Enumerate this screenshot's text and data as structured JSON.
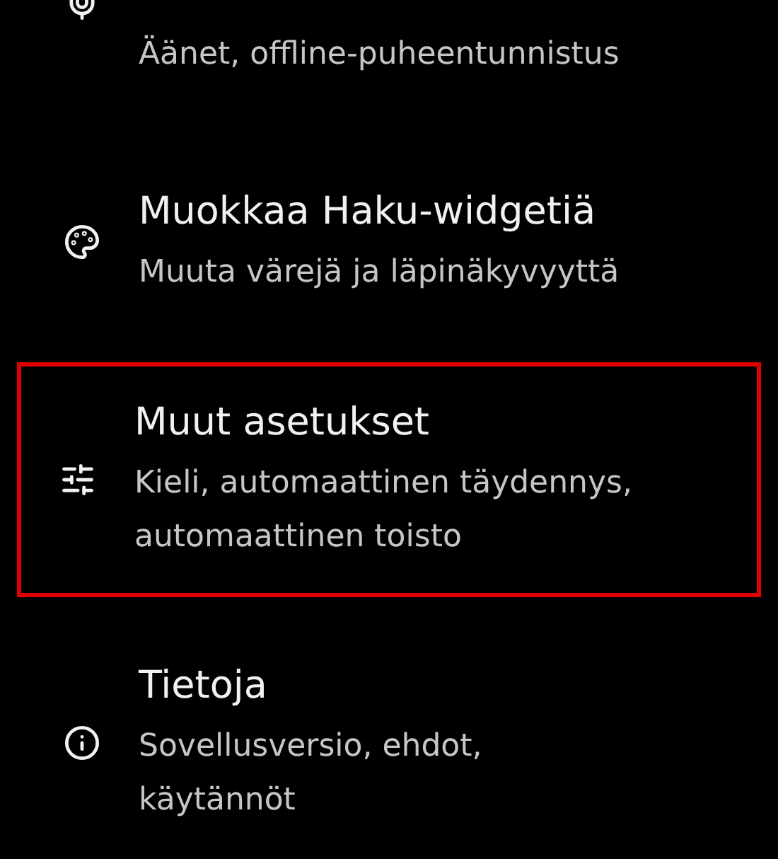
{
  "items": [
    {
      "kind": "mic",
      "subtitle": "Äänet, offline-puheentunnistus",
      "highlighted": false
    },
    {
      "kind": "palette",
      "title": "Muokkaa Haku-widgetiä",
      "subtitle": "Muuta värejä ja läpinäkyvyyttä",
      "highlighted": false
    },
    {
      "kind": "sliders",
      "title": "Muut asetukset",
      "subtitle": "Kieli, automaattinen täydennys, automaattinen toisto",
      "highlighted": true
    },
    {
      "kind": "info",
      "title": "Tietoja",
      "subtitle": "Sovellusversio, ehdot, käytännöt",
      "highlighted": false
    }
  ]
}
